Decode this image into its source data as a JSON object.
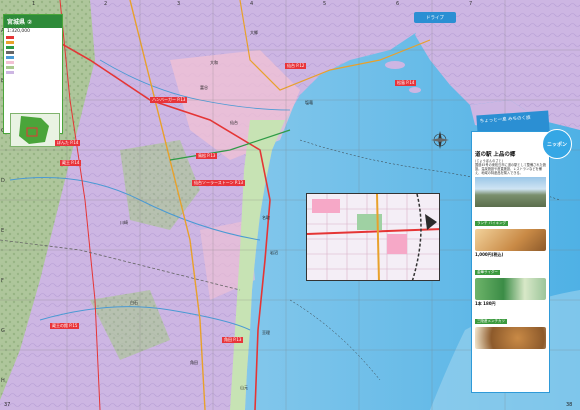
{
  "legend": {
    "title": "宮城県 ②",
    "scale": "1:320,000"
  },
  "pages": {
    "left": "37",
    "right": "38"
  },
  "grid": {
    "numbers": [
      "1",
      "2",
      "3",
      "4",
      "5",
      "6",
      "7"
    ],
    "letters": [
      "A",
      "B",
      "C",
      "D",
      "E",
      "F",
      "G",
      "H"
    ]
  },
  "map_labels": [
    "ハンバーガー P.13",
    "仙台 P.12",
    "ぽんた P.14",
    "蔵王 P.14",
    "松島 P.14",
    "鳥松 P.13",
    "仙台ソーラーストーン P.13",
    "蔵王の館 P.15",
    "角田 P.13"
  ],
  "place_names": [
    "岩沼",
    "名取",
    "亘理",
    "白石",
    "川崎",
    "仙台",
    "塩竈",
    "大郷",
    "大和",
    "富谷",
    "角田",
    "山元"
  ],
  "feature": {
    "header": "ちょっと一息 みちのく旅",
    "bubble": "ニッポン",
    "title": "道の駅 上品の郷",
    "subtitle": "(じょうぼんのさと)",
    "text": "国道45号の東松島市に道の駅として整備された施設。温泉施設や産直施設、レストランなどを備え、地域の特産品を購入できる。",
    "items": [
      {
        "tag": "ランチ バイキング",
        "price": "1,000円(税込)"
      },
      {
        "tag": "金華サイダー",
        "price": "1本 180円"
      },
      {
        "tag": "三陸産メンチカツ",
        "price": ""
      }
    ]
  },
  "corner_tag": "ドライブ"
}
